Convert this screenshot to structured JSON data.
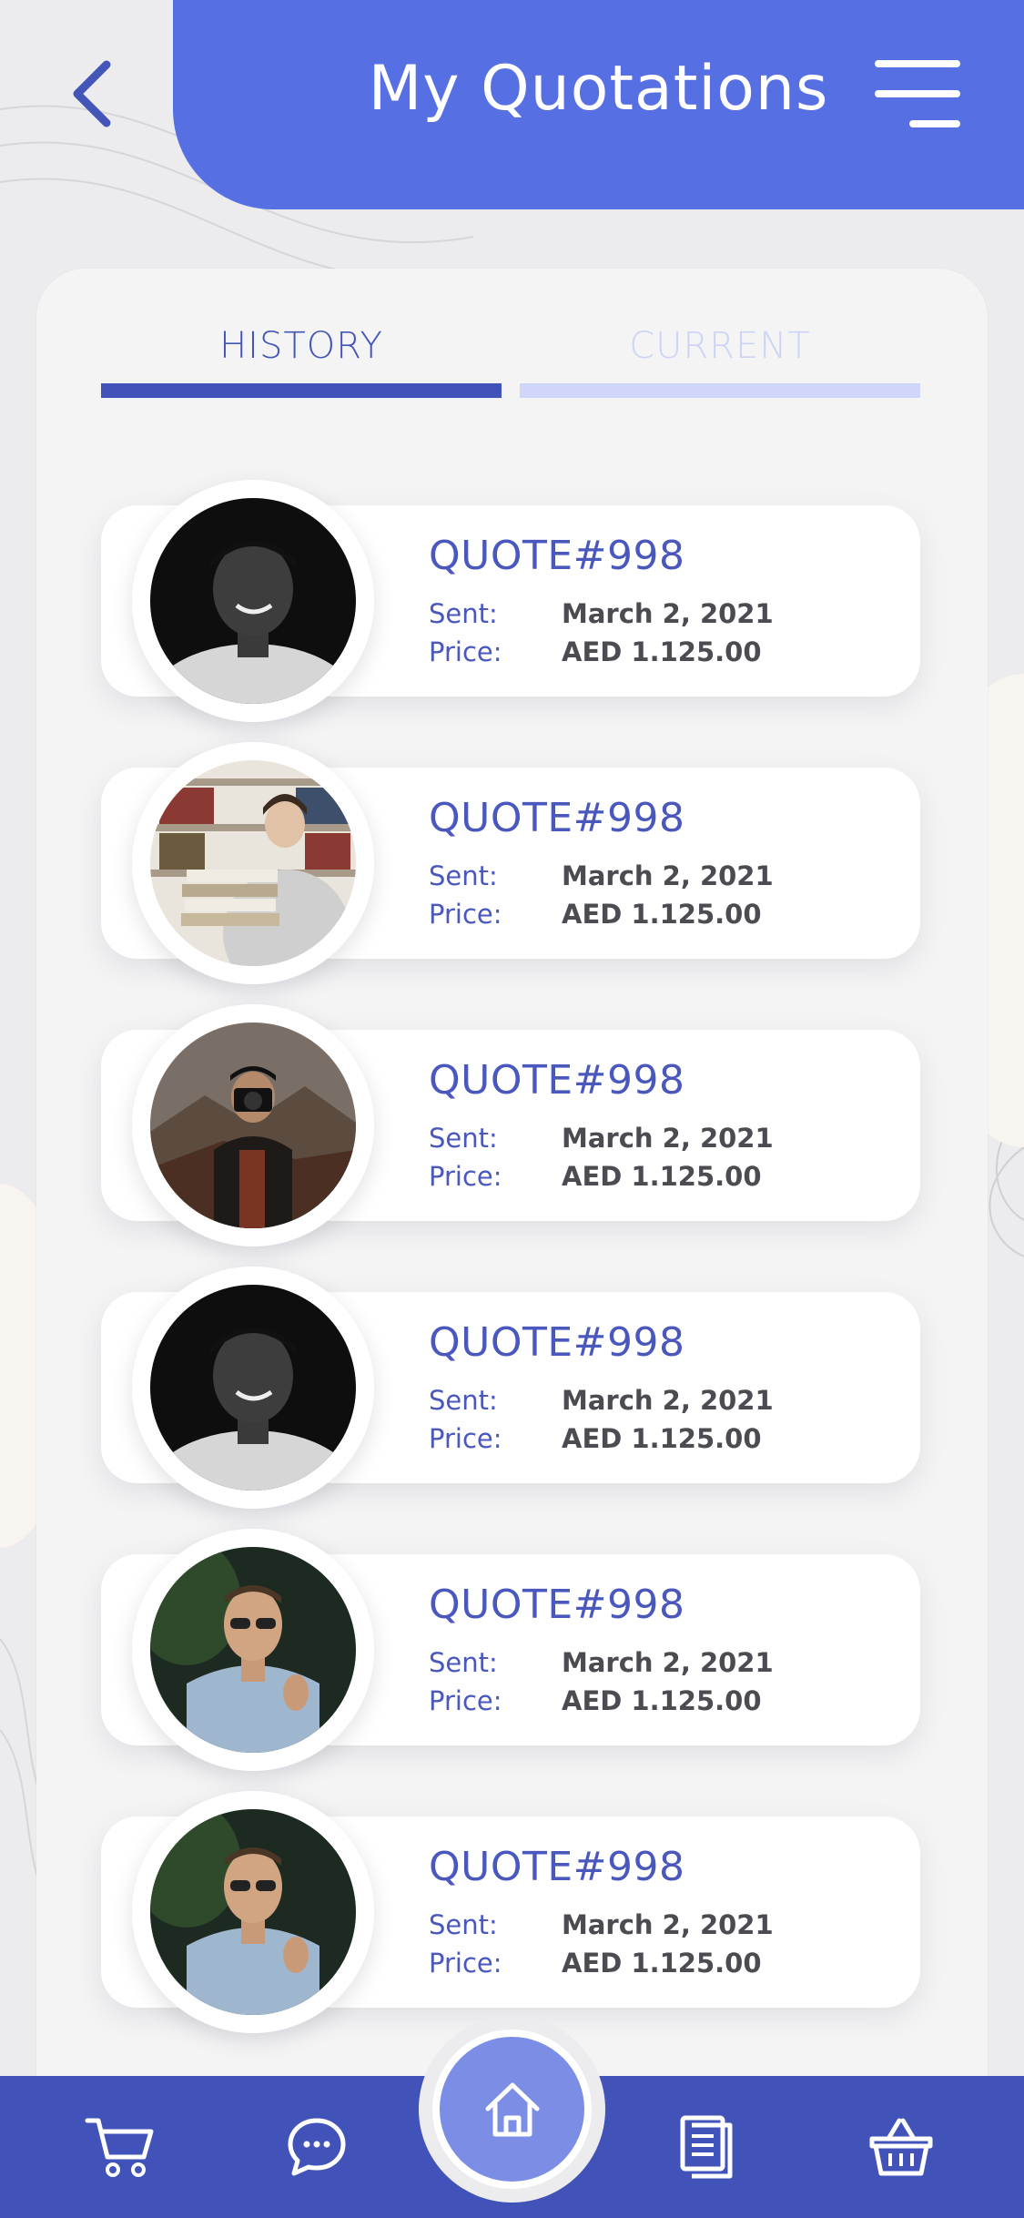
{
  "header": {
    "title": "My Quotations",
    "back_icon": "chevron-left-icon",
    "menu_icon": "hamburger-menu-icon"
  },
  "tabs": [
    {
      "label": "HISTORY",
      "active": true
    },
    {
      "label": "CURRENT",
      "active": false
    }
  ],
  "labels": {
    "sent": "Sent:",
    "price": "Price:"
  },
  "quotes": [
    {
      "title": "QUOTE#998",
      "sent": "March 2, 2021",
      "price": "AED 1.125.00",
      "avatar": "man-black-cap"
    },
    {
      "title": "QUOTE#998",
      "sent": "March 2, 2021",
      "price": "AED 1.125.00",
      "avatar": "woman-books"
    },
    {
      "title": "QUOTE#998",
      "sent": "March 2, 2021",
      "price": "AED 1.125.00",
      "avatar": "photographer-camera"
    },
    {
      "title": "QUOTE#998",
      "sent": "March 2, 2021",
      "price": "AED 1.125.00",
      "avatar": "man-black-cap"
    },
    {
      "title": "QUOTE#998",
      "sent": "March 2, 2021",
      "price": "AED 1.125.00",
      "avatar": "man-sunglasses-blue-shirt"
    },
    {
      "title": "QUOTE#998",
      "sent": "March 2, 2021",
      "price": "AED 1.125.00",
      "avatar": "man-sunglasses-blue-shirt"
    }
  ],
  "bottom_nav": [
    {
      "icon": "cart-icon"
    },
    {
      "icon": "chat-bubble-icon"
    },
    {
      "icon": "home-icon"
    },
    {
      "icon": "documents-icon"
    },
    {
      "icon": "basket-icon"
    }
  ],
  "colors": {
    "primary": "#5670e3",
    "nav": "#4153b8",
    "accent_text": "#4a57bd",
    "home_button": "#7c8de6"
  }
}
